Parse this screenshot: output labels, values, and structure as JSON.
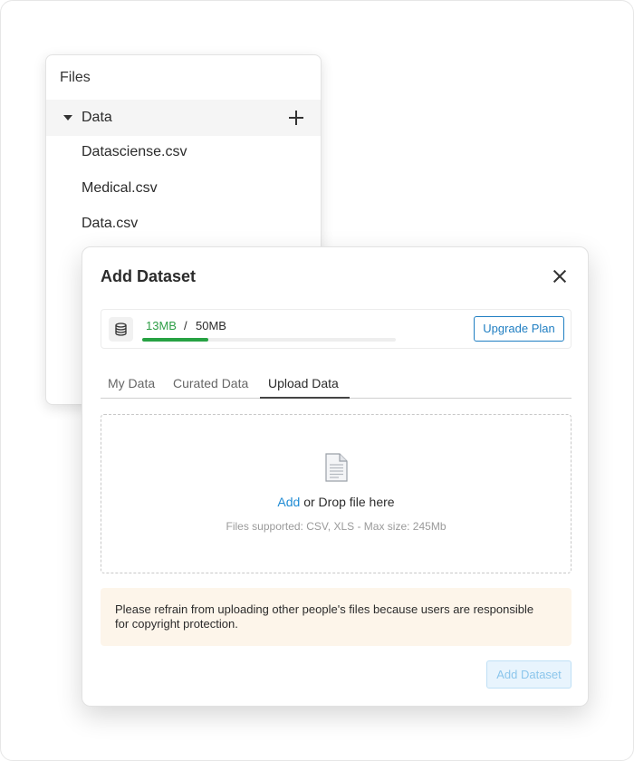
{
  "files_panel": {
    "title": "Files",
    "folder": {
      "label": "Data",
      "expanded": true
    },
    "files": [
      "Datasciense.csv",
      "Medical.csv",
      "Data.csv"
    ]
  },
  "dialog": {
    "title": "Add Dataset",
    "storage": {
      "used": "13MB",
      "separator": "/",
      "total": "50MB",
      "used_fraction": 0.26,
      "upgrade_label": "Upgrade Plan"
    },
    "tabs": [
      {
        "label": "My Data",
        "active": false
      },
      {
        "label": "Curated Data",
        "active": false
      },
      {
        "label": "Upload Data",
        "active": true
      }
    ],
    "dropzone": {
      "add_link": "Add",
      "drop_text": " or Drop file here",
      "supported": "Files supported: CSV, XLS - Max size: 245Mb"
    },
    "notice": "Please refrain from uploading other people's files because users are responsible for copyright protection.",
    "submit_label": "Add Dataset"
  },
  "colors": {
    "accent_blue": "#1f7ec2",
    "progress_green": "#27a243",
    "notice_bg": "#fdf5ea"
  }
}
